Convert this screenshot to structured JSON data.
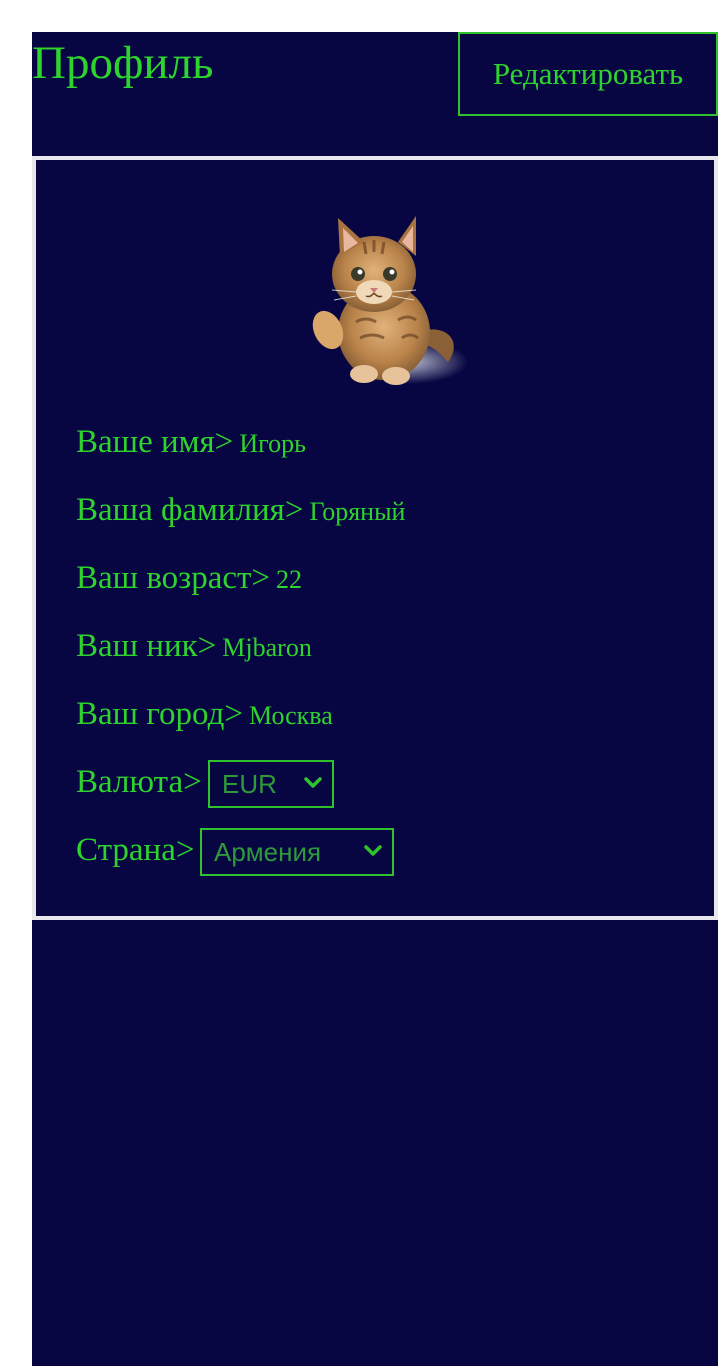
{
  "header": {
    "title": "Профиль",
    "edit_label": "Редактировать"
  },
  "profile": {
    "avatar_icon": "kitten-avatar",
    "fields": [
      {
        "label": "Ваше имя>",
        "value": "Игорь"
      },
      {
        "label": "Ваша фамилия>",
        "value": "Горяный"
      },
      {
        "label": "Ваш возраст>",
        "value": "22"
      },
      {
        "label": "Ваш ник>",
        "value": "Mjbaron"
      },
      {
        "label": "Ваш город>",
        "value": "Москва"
      }
    ],
    "currency": {
      "label": "Валюта>",
      "selected": "EUR"
    },
    "country": {
      "label": "Страна>",
      "selected": "Армения"
    }
  },
  "colors": {
    "background": "#070642",
    "accent": "#2ed32e",
    "card_border": "#e8e8ec",
    "page": "#ffffff"
  }
}
